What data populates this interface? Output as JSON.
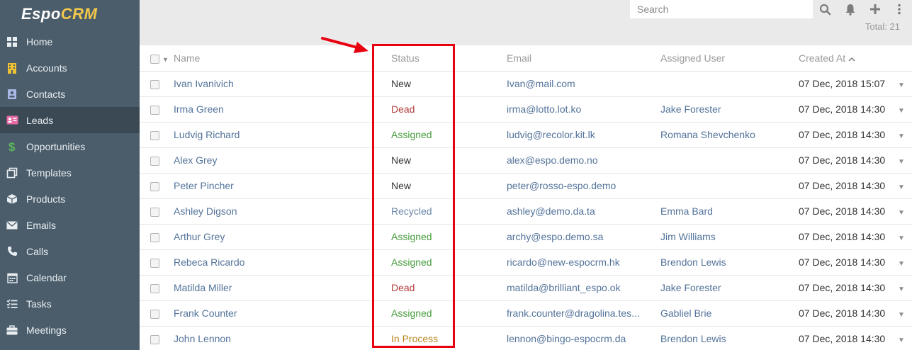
{
  "app": {
    "logo_main": "Espo",
    "logo_accent": "CRM"
  },
  "sidebar": {
    "items": [
      {
        "label": "Home",
        "icon": "grid-icon"
      },
      {
        "label": "Accounts",
        "icon": "building-icon"
      },
      {
        "label": "Contacts",
        "icon": "contact-card-icon"
      },
      {
        "label": "Leads",
        "icon": "id-card-icon",
        "active": true
      },
      {
        "label": "Opportunities",
        "icon": "dollar-icon"
      },
      {
        "label": "Templates",
        "icon": "copy-icon"
      },
      {
        "label": "Products",
        "icon": "box-icon"
      },
      {
        "label": "Emails",
        "icon": "envelope-icon"
      },
      {
        "label": "Calls",
        "icon": "phone-icon"
      },
      {
        "label": "Calendar",
        "icon": "calendar-icon"
      },
      {
        "label": "Tasks",
        "icon": "tasks-icon"
      },
      {
        "label": "Meetings",
        "icon": "briefcase-icon"
      }
    ]
  },
  "topbar": {
    "search_placeholder": "Search",
    "total_label": "Total: 21"
  },
  "table": {
    "headers": {
      "name": "Name",
      "status": "Status",
      "email": "Email",
      "assigned_user": "Assigned User",
      "created_at": "Created At"
    },
    "rows": [
      {
        "name": "Ivan Ivanivich",
        "status": "New",
        "status_class": "new",
        "email": "Ivan@mail.com",
        "user": "",
        "created": "07 Dec, 2018 15:07"
      },
      {
        "name": "Irma Green",
        "status": "Dead",
        "status_class": "dead",
        "email": "irma@lotto.lot.ko",
        "user": "Jake Forester",
        "created": "07 Dec, 2018 14:30"
      },
      {
        "name": "Ludvig Richard",
        "status": "Assigned",
        "status_class": "assigned",
        "email": "ludvig@recolor.kit.lk",
        "user": "Romana Shevchenko",
        "created": "07 Dec, 2018 14:30"
      },
      {
        "name": "Alex Grey",
        "status": "New",
        "status_class": "new",
        "email": "alex@espo.demo.no",
        "user": "",
        "created": "07 Dec, 2018 14:30"
      },
      {
        "name": "Peter Pincher",
        "status": "New",
        "status_class": "new",
        "email": "peter@rosso-espo.demo",
        "user": "",
        "created": "07 Dec, 2018 14:30"
      },
      {
        "name": "Ashley Digson",
        "status": "Recycled",
        "status_class": "recycled",
        "email": "ashley@demo.da.ta",
        "user": "Emma Bard",
        "created": "07 Dec, 2018 14:30"
      },
      {
        "name": "Arthur Grey",
        "status": "Assigned",
        "status_class": "assigned",
        "email": "archy@espo.demo.sa",
        "user": "Jim Williams",
        "created": "07 Dec, 2018 14:30"
      },
      {
        "name": "Rebeca Ricardo",
        "status": "Assigned",
        "status_class": "assigned",
        "email": "ricardo@new-espocrm.hk",
        "user": "Brendon Lewis",
        "created": "07 Dec, 2018 14:30"
      },
      {
        "name": "Matilda Miller",
        "status": "Dead",
        "status_class": "dead",
        "email": "matilda@brilliant_espo.ok",
        "user": "Jake Forester",
        "created": "07 Dec, 2018 14:30"
      },
      {
        "name": "Frank Counter",
        "status": "Assigned",
        "status_class": "assigned",
        "email": "frank.counter@dragolina.tes...",
        "user": "Gabliel Brie",
        "created": "07 Dec, 2018 14:30"
      },
      {
        "name": "John Lennon",
        "status": "In Process",
        "status_class": "inprocess",
        "email": "lennon@bingo-espocrm.da",
        "user": "Brendon Lewis",
        "created": "07 Dec, 2018 14:30"
      }
    ]
  },
  "colors": {
    "sidebar_bg": "#4b5d6b",
    "sidebar_active": "#3a4954",
    "link": "#53739a",
    "highlight": "#e8000f"
  }
}
